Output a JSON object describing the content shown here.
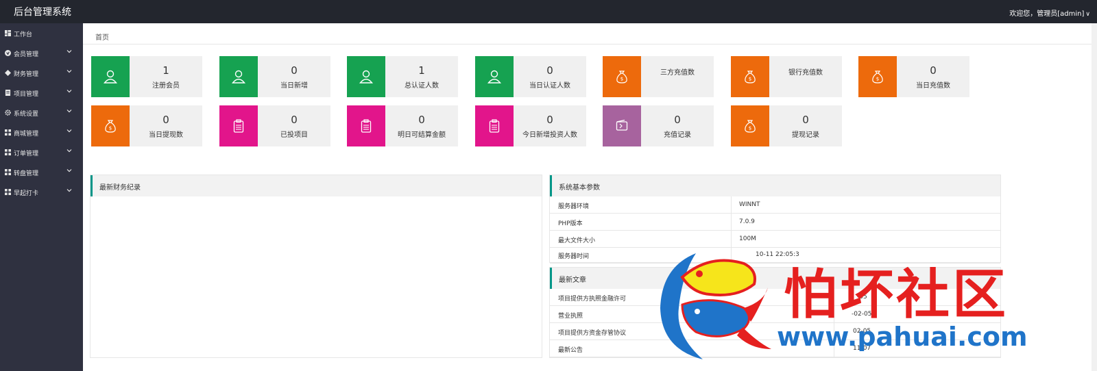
{
  "header": {
    "title": "后台管理系统",
    "welcome": "欢迎您，管理员[admin]"
  },
  "sidebar": {
    "items": [
      {
        "label": "工作台",
        "icon": "dashboard-icon",
        "has_children": false
      },
      {
        "label": "会员管理",
        "icon": "member-icon",
        "has_children": true
      },
      {
        "label": "财务管理",
        "icon": "finance-icon",
        "has_children": true
      },
      {
        "label": "项目管理",
        "icon": "project-icon",
        "has_children": true
      },
      {
        "label": "系统设置",
        "icon": "gear-icon",
        "has_children": true
      },
      {
        "label": "商城管理",
        "icon": "shop-icon",
        "has_children": true
      },
      {
        "label": "订单管理",
        "icon": "order-icon",
        "has_children": true
      },
      {
        "label": "转盘管理",
        "icon": "wheel-icon",
        "has_children": true
      },
      {
        "label": "早起打卡",
        "icon": "checkin-icon",
        "has_children": true
      }
    ]
  },
  "breadcrumb": "首页",
  "colors": {
    "green": "#16a251",
    "orange": "#ed6a0c",
    "magenta": "#e2158b",
    "purple": "#a7639e"
  },
  "stats": [
    {
      "value": "1",
      "label": "注册会员",
      "color": "#16a251",
      "icon": "user-icon"
    },
    {
      "value": "0",
      "label": "当日新增",
      "color": "#16a251",
      "icon": "user-icon"
    },
    {
      "value": "1",
      "label": "总认证人数",
      "color": "#16a251",
      "icon": "user-icon"
    },
    {
      "value": "0",
      "label": "当日认证人数",
      "color": "#16a251",
      "icon": "user-icon"
    },
    {
      "value": "",
      "label": "三方充值数",
      "color": "#ed6a0c",
      "icon": "money-bag-icon"
    },
    {
      "value": "",
      "label": "银行充值数",
      "color": "#ed6a0c",
      "icon": "money-bag-icon"
    },
    {
      "value": "0",
      "label": "当日充值数",
      "color": "#ed6a0c",
      "icon": "money-bag-icon"
    },
    {
      "value": "0",
      "label": "当日提现数",
      "color": "#ed6a0c",
      "icon": "money-bag-icon"
    },
    {
      "value": "0",
      "label": "已投项目",
      "color": "#e2158b",
      "icon": "clipboard-icon"
    },
    {
      "value": "0",
      "label": "明日可结算金额",
      "color": "#e2158b",
      "icon": "clipboard-icon"
    },
    {
      "value": "0",
      "label": "今日新增投资人数",
      "color": "#e2158b",
      "icon": "clipboard-icon"
    },
    {
      "value": "0",
      "label": "充值记录",
      "color": "#a7639e",
      "icon": "wallet-icon"
    },
    {
      "value": "0",
      "label": "提现记录",
      "color": "#ed6a0c",
      "icon": "money-bag-icon"
    }
  ],
  "finance_panel": {
    "title": "最新财务纪录"
  },
  "system_panel": {
    "title": "系统基本参数",
    "rows": [
      {
        "key": "服务器环境",
        "value": "WINNT"
      },
      {
        "key": "PHP版本",
        "value": "7.0.9"
      },
      {
        "key": "最大文件大小",
        "value": "100M"
      },
      {
        "key": "服务器时间",
        "value": "10-11 22:05:3"
      }
    ]
  },
  "articles_panel": {
    "title": "最新文章",
    "rows": [
      {
        "title": "项目提供方执照金融许可",
        "date": "-05"
      },
      {
        "title": "营业执照",
        "date": "-02-05"
      },
      {
        "title": "项目提供方资金存管协议",
        "date": "02-05"
      },
      {
        "title": "最新公告",
        "date": "11-07"
      }
    ]
  },
  "watermark": {
    "text_cn": "怕坏社区",
    "url": "www.pahuai.com"
  }
}
